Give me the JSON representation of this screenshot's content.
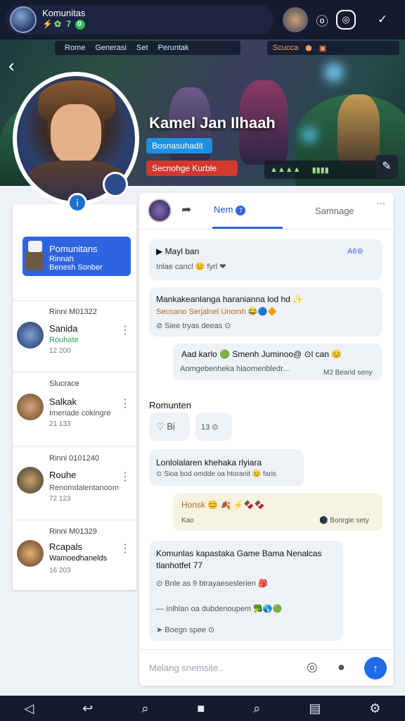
{
  "topbar": {
    "title": "Komunitas",
    "stats": "⚡✿ 7",
    "badge": "0",
    "btn1_icon": "helmet-avatar-icon",
    "btn2_icon": "edit-icon",
    "btn3_icon": "check-icon",
    "btn2": "ⓞ",
    "btn3": "✓"
  },
  "banner": {
    "menu": [
      "Rome",
      "Generasi",
      "Set",
      "Peruntak"
    ],
    "menu_right": [
      "Scucca",
      "⬢",
      "▣"
    ],
    "game_title": "Kamel Jan Ilhaah",
    "tag_blue": "Bosnasuhadit",
    "tag_red": "Secnohge Kurble",
    "stats": [
      "▲▲▲▲",
      "▮▮▮▮"
    ],
    "back": "‹",
    "tool": "✎"
  },
  "left": {
    "community_card": {
      "title": "Pomunitans",
      "line2": "Rinnah",
      "line3": "Benesh Sonber"
    },
    "members": [
      {
        "time": "Rinni M01322",
        "name": "Sanida",
        "sub": "Rouhate",
        "meta": "12 200"
      },
      {
        "time": "Slucrace",
        "name": "Salkak",
        "sub": "Imeriade cokingre",
        "meta": "21 133"
      },
      {
        "time": "Rinni 0101240",
        "name": "Rouhe",
        "sub": "Renomdalentanoom",
        "meta": "72 123"
      },
      {
        "time": "Rinni M01329",
        "name": "Rcapals",
        "sub": "Wamoedhanelds",
        "meta": "16 203"
      }
    ]
  },
  "chat": {
    "tab_active": "Nem",
    "tab_active_badge": "7",
    "tab_2": "Samnage",
    "messages": [
      {
        "title": "Mayl ban",
        "line": "Inlae cancl 😊 fyrl ❤",
        "right": "A6⊚"
      },
      {
        "title": "Mankakeanlanga haranianna lod hd ✨",
        "line": "Secoano Serjalnel Unomh 😂🔵🔶",
        "meta": "⊘ Siee tryas deeas ⊙"
      },
      {
        "title": "Aad karlo 🟢 Smenh Juminoo@ ⊙l can 😊",
        "line": "Aomgebenheka hlaomenbledr...",
        "meta": "M2 Bearid seny"
      },
      {
        "title": "Romunten",
        "line": "♡  Bi",
        "meta": "13 ⊙"
      },
      {
        "title": "Lonlolalaren khehaka rlyiara",
        "line": "⊙ Sioa bod omdde oa htoranit 😊 faris"
      },
      {
        "title": "Honsk 😊 🍂 ⚡🍫🍫",
        "line": "Kao",
        "meta": "🌑 Bonrgie sety"
      },
      {
        "title": "Komunlas kapastaka Game Bama Nenalcas tlanhotfet 77",
        "line": "⊙  Bnle as 9 btrayaeseslerien 🎒",
        "line2": "— Inlhlan oa dubdenoupem 🥦🌎🟢",
        "meta": "➤ Boegn spee ⊙"
      }
    ],
    "composer_placeholder": "Melang snemsite..",
    "composer_icons": [
      "◎",
      "●"
    ],
    "send": "↑"
  },
  "navbar": [
    "◁",
    "↩",
    "⌕",
    "■",
    "⌕",
    "▤",
    "⚙"
  ]
}
